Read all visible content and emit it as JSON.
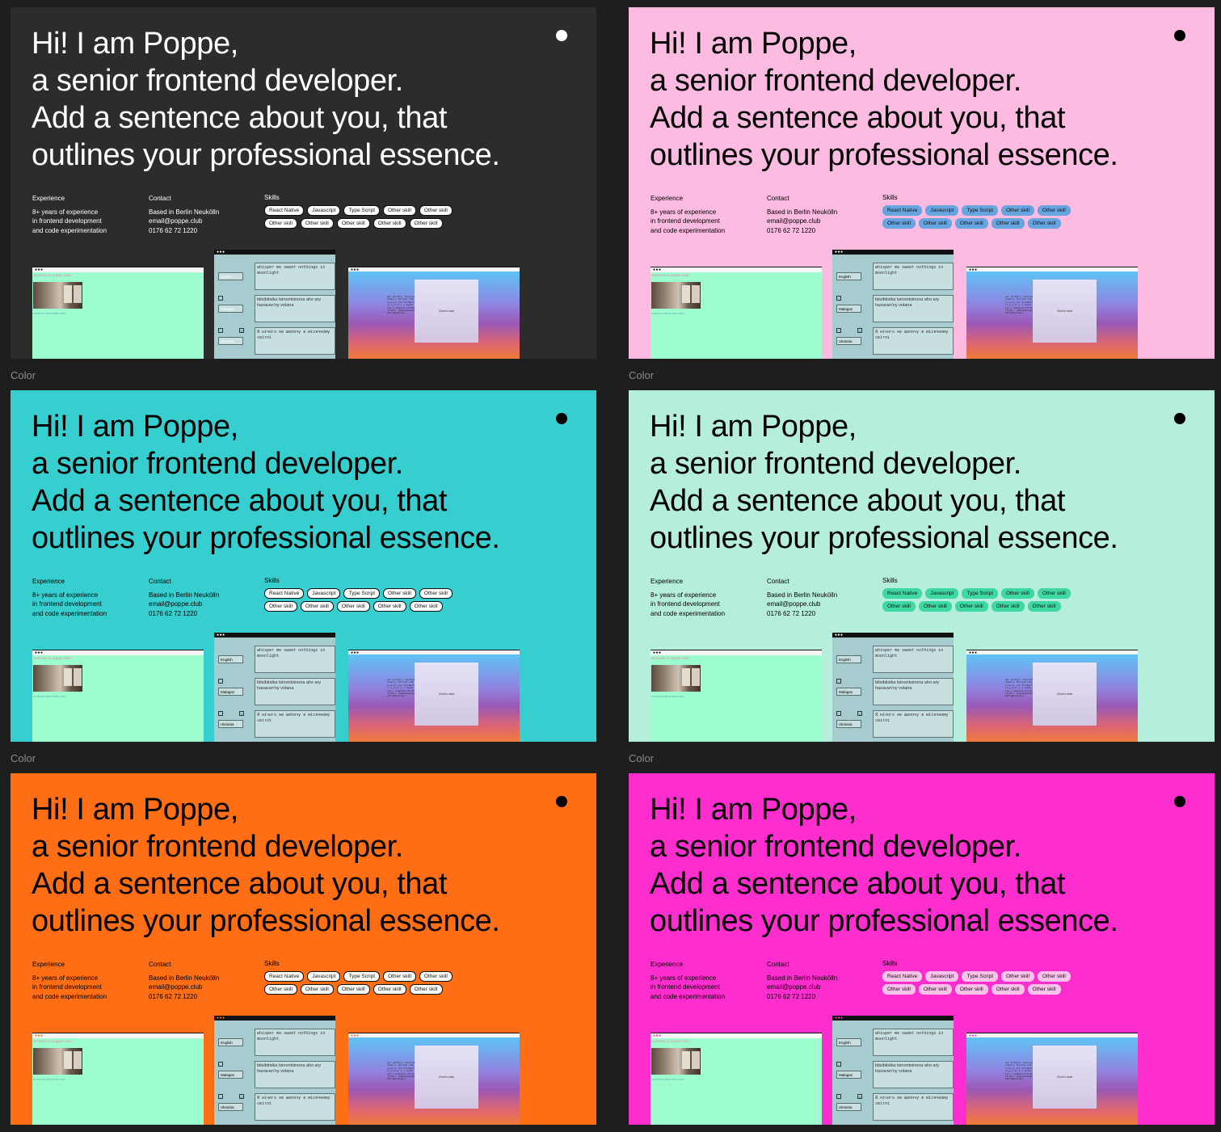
{
  "hero": {
    "line1": "Hi! I am Poppe,",
    "line2": "a senior frontend developer.",
    "line3": "Add a sentence about you, that",
    "line4": "outlines your professional essence."
  },
  "experience": {
    "heading": "Experience",
    "line1": "8+ years of experience",
    "line2": "in frontend development",
    "line3": "and code experimentation"
  },
  "contact": {
    "heading": "Contact",
    "location": "Based in Berlin Neukölln",
    "email": "email@poppe.club",
    "phone": "0176 62 72 1220"
  },
  "skills": {
    "heading": "Skills",
    "items": [
      "React Native",
      "Javascript",
      "Type Script",
      "Other skill",
      "Other skill",
      "Other skill",
      "Other skill",
      "Other skill",
      "Other skill",
      "Other skill"
    ]
  },
  "mockups": {
    "window_dots": "●●●",
    "welcome": "welcome to poppe.club !",
    "caption": "some text about this room",
    "languages": [
      "English",
      "Malagas",
      "Ukrainia"
    ],
    "texts": [
      "whisper me sweet nothings in moonlight",
      "bitsibitsika tsinontsinona aho ary hazavan'ny volana",
      "Я нічого не шепочу в місячному світлі"
    ],
    "code": "var grid=[]; function draw(){ for(let i=0;i<w;i++){ ctx.fillRect(x,y,1,1) } } const noise = simplex(x*0.01,y*0.01); requestAnimationFrame(draw);",
    "card_label": "Click to start"
  },
  "frame_label": "Color",
  "themes": [
    {
      "bg": "#2c2c2c",
      "text": "#ffffff",
      "dot": "#ffffff",
      "chip_bg": "#ffffff",
      "chip_text": "#111111",
      "chip_border": "#111111",
      "dots_color": "#ffffff"
    },
    {
      "bg": "#fdbbe2",
      "text": "#000000",
      "dot": "#000000",
      "chip_bg": "#67a5e1",
      "chip_text": "#111111",
      "chip_border": "#67a5e1",
      "dots_color": "#ffffff"
    },
    {
      "bg": "#36cece",
      "text": "#000000",
      "dot": "#000000",
      "chip_bg": "#ffffff",
      "chip_text": "#111111",
      "chip_border": "#111111",
      "dots_color": "#ffffff"
    },
    {
      "bg": "#b6eedd",
      "text": "#000000",
      "dot": "#000000",
      "chip_bg": "#3ed9a0",
      "chip_text": "#111111",
      "chip_border": "#3ed9a0",
      "dots_color": "#ffffff"
    },
    {
      "bg": "#ff6d14",
      "text": "#000000",
      "dot": "#000000",
      "chip_bg": "#ffffff",
      "chip_text": "#111111",
      "chip_border": "#111111",
      "dots_color": "#ff6d14"
    },
    {
      "bg": "#fd2ecd",
      "text": "#000000",
      "dot": "#000000",
      "chip_bg": "#fdc2ec",
      "chip_text": "#111111",
      "chip_border": "#fdc2ec",
      "dots_color": "#fd2ecd"
    }
  ]
}
